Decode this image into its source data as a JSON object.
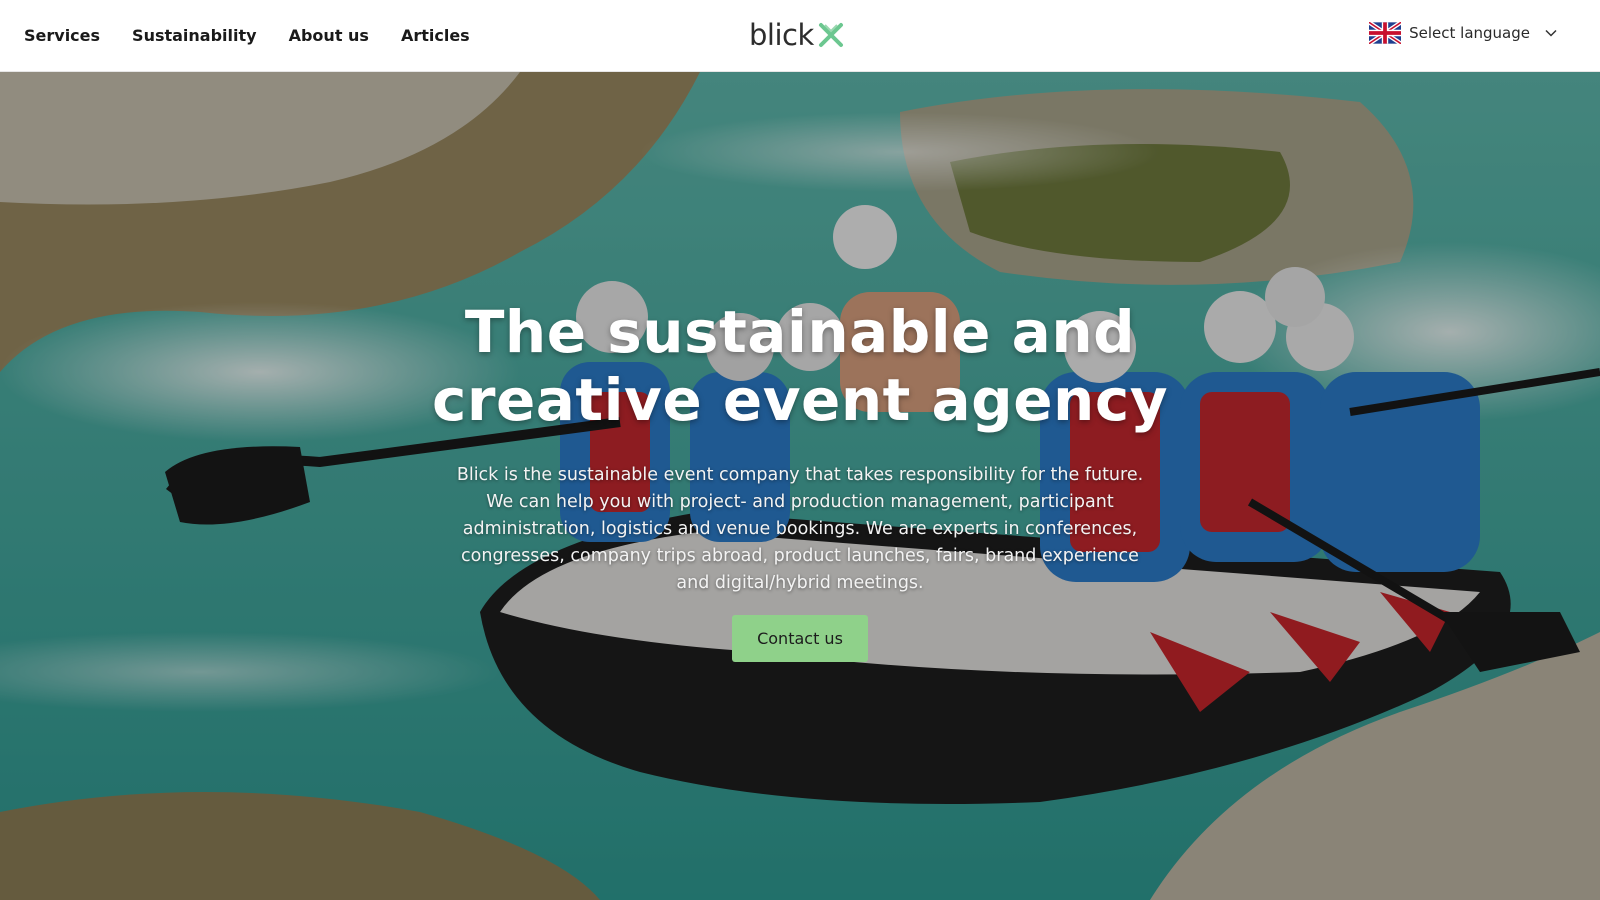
{
  "header": {
    "nav": [
      {
        "label": "Services"
      },
      {
        "label": "Sustainability"
      },
      {
        "label": "About us"
      },
      {
        "label": "Articles"
      }
    ],
    "logo_text": "blick",
    "language": {
      "label": "Select language",
      "flag_icon": "uk-flag-icon"
    }
  },
  "hero": {
    "title": "The sustainable and creative event agency",
    "description": "Blick is the sustainable event company that takes responsibility for the future. We can help you with project- and production management, participant administration, logistics and venue bookings. We are experts in conferences, congresses, company trips abroad, product launches, fairs, brand experience and digital/hybrid meetings.",
    "cta_label": "Contact us",
    "background_description": "white-water rafting photo"
  },
  "colors": {
    "cta": "#8fd18a",
    "logo_mark": "#6cc790",
    "text_dark": "#1a1a1a"
  }
}
